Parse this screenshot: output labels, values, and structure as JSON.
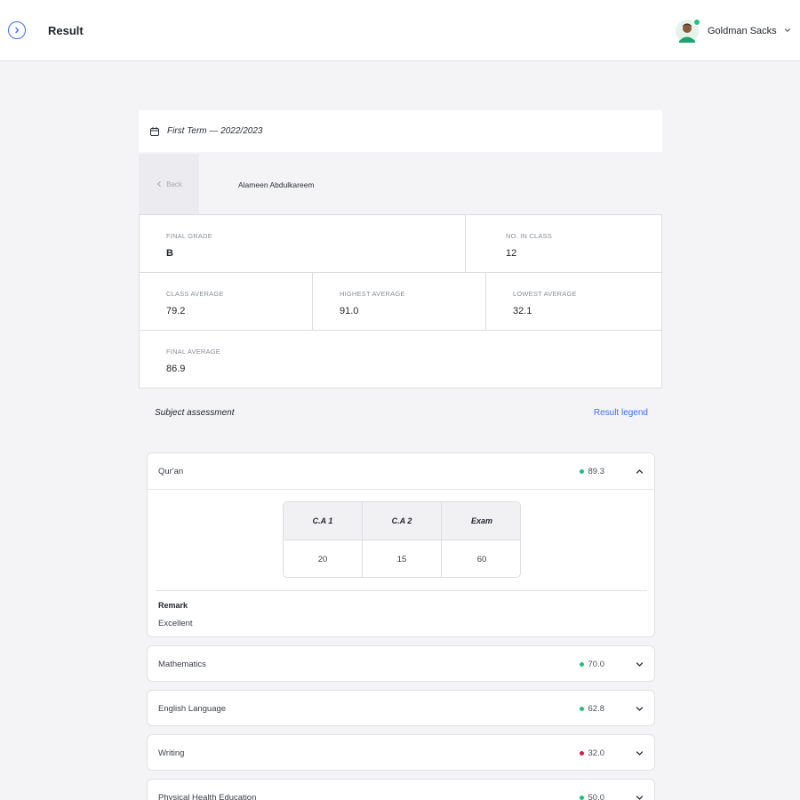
{
  "header": {
    "title": "Result",
    "user_name": "Goldman Sacks"
  },
  "term": {
    "label": "First Term — 2022/2023"
  },
  "student": {
    "back_label": "Back",
    "name": "Alameen Abdulkareem"
  },
  "stats": {
    "final_grade": {
      "label": "FINAL GRADE",
      "value": "B"
    },
    "no_in_class": {
      "label": "NO. IN CLASS",
      "value": "12"
    },
    "class_average": {
      "label": "CLASS AVERAGE",
      "value": "79.2"
    },
    "highest_average": {
      "label": "HIGHEST AVERAGE",
      "value": "91.0"
    },
    "lowest_average": {
      "label": "LOWEST AVERAGE",
      "value": "32.1"
    },
    "final_average": {
      "label": "FINAL AVERAGE",
      "value": "86.9"
    }
  },
  "assessment": {
    "title": "Subject assessment",
    "legend_link": "Result legend"
  },
  "colors": {
    "accent": "#3b6ff5",
    "good": "#20c07a",
    "bad": "#d81b4a"
  },
  "subjects": [
    {
      "name": "Qur'an",
      "score": "89.3",
      "status": "good",
      "expanded": true,
      "breakdown": {
        "headers": [
          "C.A 1",
          "C.A 2",
          "Exam"
        ],
        "values": [
          "20",
          "15",
          "60"
        ]
      },
      "remark_label": "Remark",
      "remark": "Excellent"
    },
    {
      "name": "Mathematics",
      "score": "70.0",
      "status": "good",
      "expanded": false
    },
    {
      "name": "English Language",
      "score": "62.8",
      "status": "good",
      "expanded": false
    },
    {
      "name": "Writing",
      "score": "32.0",
      "status": "bad",
      "expanded": false
    },
    {
      "name": "Physical Health Education",
      "score": "50.0",
      "status": "good",
      "expanded": false
    }
  ]
}
